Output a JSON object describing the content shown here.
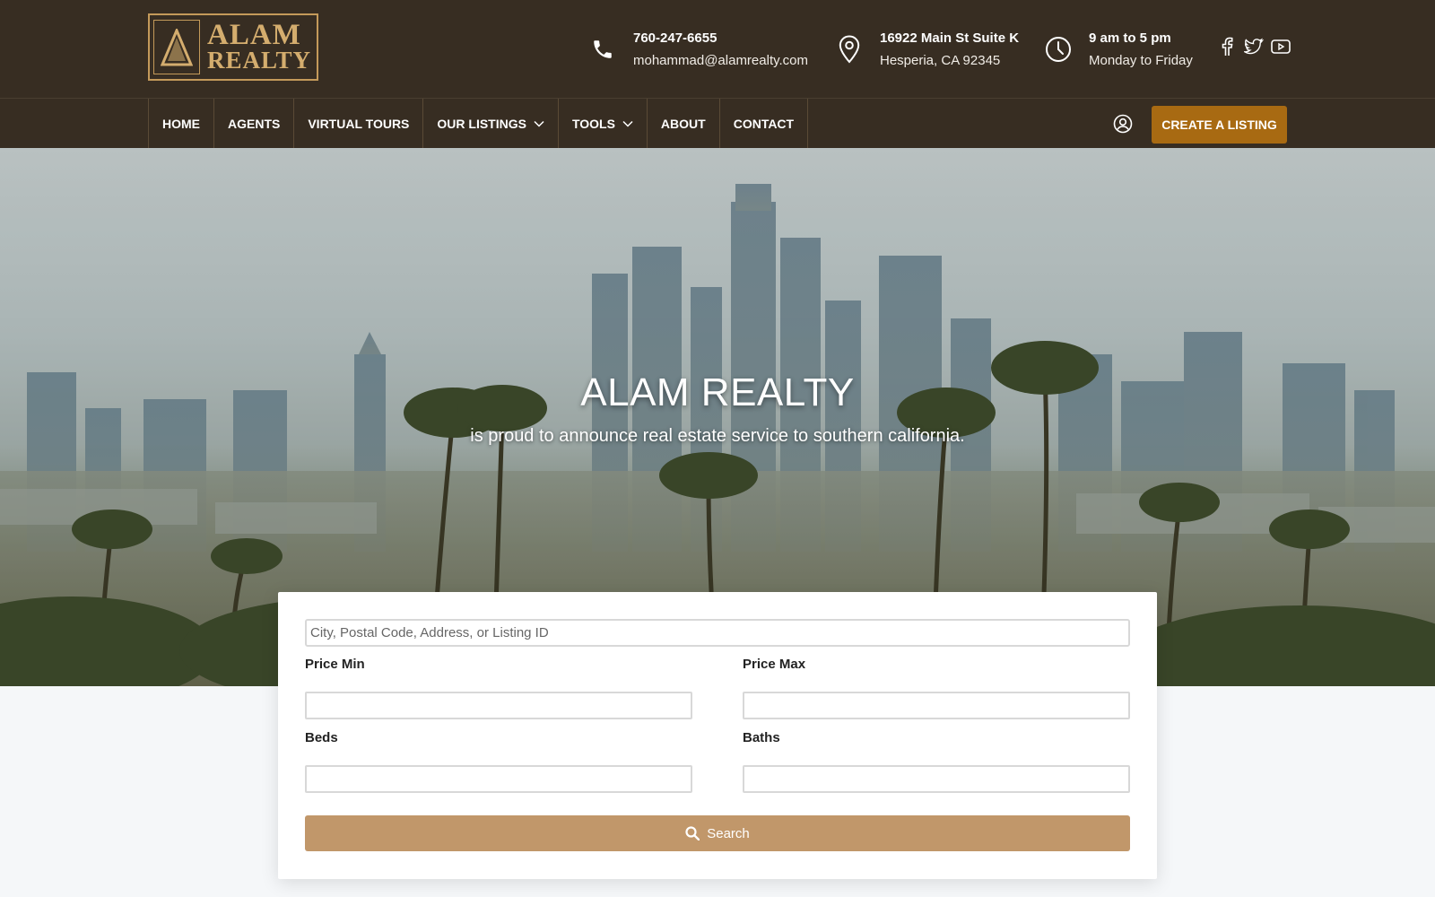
{
  "brand": {
    "logo_line1": "ALAM",
    "logo_line2": "REALTY"
  },
  "header": {
    "phone": "760-247-6655",
    "email": "mohammad@alamrealty.com",
    "address_line1": "16922 Main St Suite K",
    "address_line2": "Hesperia, CA 92345",
    "hours_line1": "9 am to 5 pm",
    "hours_line2": "Monday to Friday",
    "social": [
      "facebook-icon",
      "twitter-icon",
      "youtube-icon"
    ]
  },
  "nav": {
    "items": [
      {
        "label": "HOME"
      },
      {
        "label": "AGENTS"
      },
      {
        "label": "VIRTUAL TOURS"
      },
      {
        "label": "OUR LISTINGS"
      },
      {
        "label": "TOOLS"
      },
      {
        "label": "ABOUT"
      },
      {
        "label": "CONTACT"
      }
    ],
    "cta_label": "CREATE A LISTING"
  },
  "hero": {
    "title": "ALAM REALTY",
    "subtitle": "is proud to announce real estate service to southern california."
  },
  "search": {
    "placeholder": "City, Postal Code, Address, or Listing ID",
    "value": "",
    "price_min_label": "Price Min",
    "price_max_label": "Price Max",
    "beds_label": "Beds",
    "baths_label": "Baths",
    "button_label": "Search"
  },
  "colors": {
    "header_bg": "#372d22",
    "brand_gold": "#c49a5a",
    "cta_bg": "#a86a12",
    "search_button_bg": "#c1976a"
  }
}
